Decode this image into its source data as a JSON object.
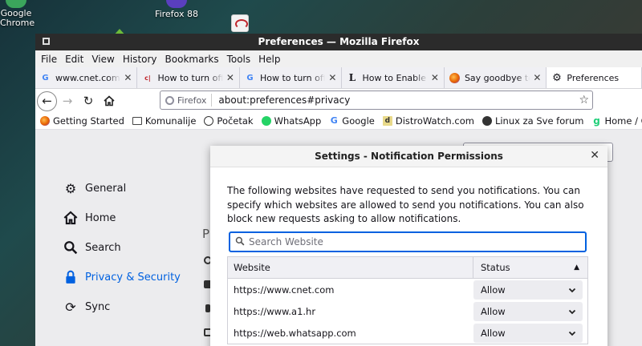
{
  "desktop": {
    "icons": [
      {
        "label": "Google\nChrome"
      },
      {
        "label": "Firefox 88"
      }
    ]
  },
  "window": {
    "title": "Preferences — Mozilla Firefox"
  },
  "menubar": [
    "File",
    "Edit",
    "View",
    "History",
    "Bookmarks",
    "Tools",
    "Help"
  ],
  "tabs": [
    {
      "title": "www.cnet.com stu",
      "icon": "google-icon",
      "color": "#4285f4"
    },
    {
      "title": "How to turn off Go",
      "icon": "cnet-icon",
      "color": "#c0272d"
    },
    {
      "title": "How to turn off Fir",
      "icon": "google-icon",
      "color": "#4285f4"
    },
    {
      "title": "How to Enable an",
      "icon": "l-icon",
      "color": "#222222"
    },
    {
      "title": "Say goodbye to a",
      "icon": "firefox-icon",
      "color": "#e66000"
    },
    {
      "title": "Preferences",
      "icon": "gear-icon",
      "active": true
    }
  ],
  "navbar": {
    "identity_label": "Firefox",
    "url": "about:preferences#privacy"
  },
  "bookmarks": [
    {
      "label": "Getting Started",
      "icon": "firefox-icon",
      "color": "#e66000"
    },
    {
      "label": "Komunalije",
      "icon": "folder-icon",
      "color": "#555555"
    },
    {
      "label": "Početak",
      "icon": "globe-icon",
      "color": "#333333"
    },
    {
      "label": "WhatsApp",
      "icon": "whatsapp-icon",
      "color": "#25d366"
    },
    {
      "label": "Google",
      "icon": "google-icon",
      "color": "#4285f4"
    },
    {
      "label": "DistroWatch.com",
      "icon": "distrowatch-icon",
      "color": "#3b5998"
    },
    {
      "label": "Linux za Sve forum",
      "icon": "penguin-icon",
      "color": "#333333"
    },
    {
      "label": "Home / Gab Social",
      "icon": "gab-icon",
      "color": "#21cf7a"
    }
  ],
  "sidebar": [
    {
      "label": "General",
      "icon": "gear-icon"
    },
    {
      "label": "Home",
      "icon": "home-icon"
    },
    {
      "label": "Search",
      "icon": "search-icon"
    },
    {
      "label": "Privacy & Security",
      "icon": "lock-icon",
      "active": true
    },
    {
      "label": "Sync",
      "icon": "sync-icon"
    }
  ],
  "content": {
    "heading_fragment": "P"
  },
  "dialog": {
    "title": "Settings - Notification Permissions",
    "description": "The following websites have requested to send you notifications. You can specify which websites are allowed to send you notifications. You can also block new requests asking to allow notifications.",
    "search_placeholder": "Search Website",
    "columns": {
      "website": "Website",
      "status": "Status"
    },
    "rows": [
      {
        "site": "https://www.cnet.com",
        "status": "Allow"
      },
      {
        "site": "https://www.a1.hr",
        "status": "Allow"
      },
      {
        "site": "https://web.whatsapp.com",
        "status": "Allow"
      }
    ]
  }
}
